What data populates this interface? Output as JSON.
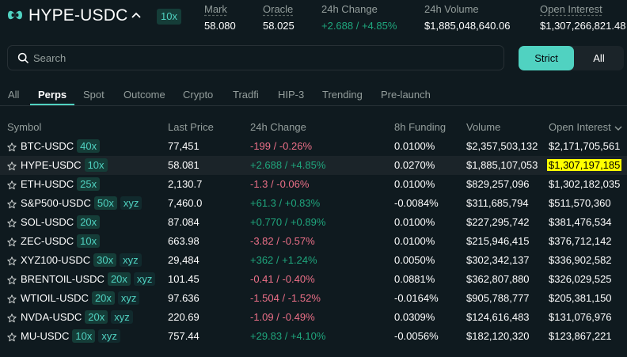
{
  "header": {
    "pair": "HYPE-USDC",
    "leverage": "10x",
    "stats": [
      {
        "label": "Mark",
        "value": "58.080",
        "underlined": true
      },
      {
        "label": "Oracle",
        "value": "58.025",
        "underlined": true
      },
      {
        "label": "24h Change",
        "value": "+2.688 / +4.85%",
        "underlined": false
      },
      {
        "label": "24h Volume",
        "value": "$1,885,048,640.06",
        "underlined": false
      },
      {
        "label": "Open Interest",
        "value": "$1,307,266,821.48",
        "underlined": true
      }
    ],
    "colors": {
      "accent": "#50d2c1",
      "positive": "#1fa67d",
      "negative": "#ed7088",
      "background": "#0f1a1f"
    }
  },
  "search": {
    "placeholder": "Search"
  },
  "filter_toggle": {
    "strict": "Strict",
    "all": "All",
    "selected": "Strict"
  },
  "tabs": [
    {
      "label": "All"
    },
    {
      "label": "Perps"
    },
    {
      "label": "Spot"
    },
    {
      "label": "Outcome"
    },
    {
      "label": "Crypto"
    },
    {
      "label": "Tradfi"
    },
    {
      "label": "HIP-3"
    },
    {
      "label": "Trending"
    },
    {
      "label": "Pre-launch"
    }
  ],
  "active_tab": "Perps",
  "table": {
    "columns": [
      "Symbol",
      "Last Price",
      "24h Change",
      "8h Funding",
      "Volume",
      "Open Interest"
    ],
    "sort_column": "Open Interest",
    "sort_direction": "descending",
    "rows": [
      {
        "symbol": "BTC-USDC",
        "leverage": "40x",
        "dex": "",
        "price": "77,451",
        "change": "-199 / -0.26%",
        "dir": "down",
        "funding": "0.0100%",
        "volume": "$2,357,503,132",
        "oi": "$2,171,705,561"
      },
      {
        "symbol": "HYPE-USDC",
        "leverage": "10x",
        "dex": "",
        "price": "58.081",
        "change": "+2.688 / +4.85%",
        "dir": "up",
        "funding": "0.0270%",
        "volume": "$1,885,107,053",
        "oi": "$1,307,197,185",
        "highlighted": true
      },
      {
        "symbol": "ETH-USDC",
        "leverage": "25x",
        "dex": "",
        "price": "2,130.7",
        "change": "-1.3 / -0.06%",
        "dir": "down",
        "funding": "0.0100%",
        "volume": "$829,257,096",
        "oi": "$1,302,182,035"
      },
      {
        "symbol": "S&P500-USDC",
        "leverage": "50x",
        "dex": "xyz",
        "price": "7,460.0",
        "change": "+61.3 / +0.83%",
        "dir": "up",
        "funding": "-0.0084%",
        "volume": "$311,685,794",
        "oi": "$511,570,360"
      },
      {
        "symbol": "SOL-USDC",
        "leverage": "20x",
        "dex": "",
        "price": "87.084",
        "change": "+0.770 / +0.89%",
        "dir": "up",
        "funding": "0.0100%",
        "volume": "$227,295,742",
        "oi": "$381,476,534"
      },
      {
        "symbol": "ZEC-USDC",
        "leverage": "10x",
        "dex": "",
        "price": "663.98",
        "change": "-3.82 / -0.57%",
        "dir": "down",
        "funding": "0.0100%",
        "volume": "$215,946,415",
        "oi": "$376,712,142"
      },
      {
        "symbol": "XYZ100-USDC",
        "leverage": "30x",
        "dex": "xyz",
        "price": "29,484",
        "change": "+362 / +1.24%",
        "dir": "up",
        "funding": "0.0050%",
        "volume": "$302,342,137",
        "oi": "$336,902,582"
      },
      {
        "symbol": "BRENTOIL-USDC",
        "leverage": "20x",
        "dex": "xyz",
        "price": "101.45",
        "change": "-0.41 / -0.40%",
        "dir": "down",
        "funding": "0.0881%",
        "volume": "$362,807,880",
        "oi": "$326,029,525"
      },
      {
        "symbol": "WTIOIL-USDC",
        "leverage": "20x",
        "dex": "xyz",
        "price": "97.636",
        "change": "-1.504 / -1.52%",
        "dir": "down",
        "funding": "-0.0164%",
        "volume": "$905,788,777",
        "oi": "$205,381,150"
      },
      {
        "symbol": "NVDA-USDC",
        "leverage": "20x",
        "dex": "xyz",
        "price": "220.69",
        "change": "-1.09 / -0.49%",
        "dir": "down",
        "funding": "0.0309%",
        "volume": "$124,616,483",
        "oi": "$131,076,976"
      },
      {
        "symbol": "MU-USDC",
        "leverage": "10x",
        "dex": "xyz",
        "price": "757.44",
        "change": "+29.83 / +4.10%",
        "dir": "up",
        "funding": "-0.0056%",
        "volume": "$182,120,320",
        "oi": "$123,867,221"
      }
    ]
  }
}
